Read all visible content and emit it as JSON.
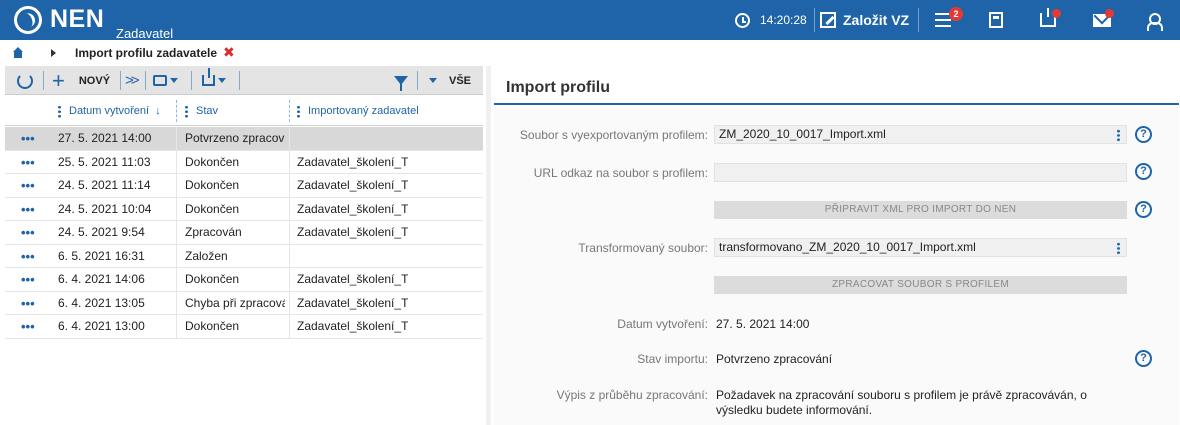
{
  "topbar": {
    "logo": "NEN",
    "logo_sub": "Zadavatel",
    "time": "14:20:28",
    "create_label": "Založit VZ",
    "menu_badge": "2",
    "colors": {
      "brand": "#1f64a8",
      "badge": "#e53935"
    }
  },
  "breadcrumb": {
    "current": "Import profilu zadavatele",
    "close": "✖"
  },
  "toolbar": {
    "new_label": "NOVÝ",
    "all_label": "VŠE"
  },
  "table": {
    "columns": [
      "Datum vytvoření",
      "Stav",
      "Importovaný zadavatel"
    ],
    "sort_indicator": "↓",
    "row_menu": "•••",
    "rows": [
      {
        "date": "27. 5. 2021 14:00",
        "state": "Potvrzeno zpracování",
        "importer": ""
      },
      {
        "date": "25. 5. 2021 11:03",
        "state": "Dokončen",
        "importer": "Zadavatel_školení_T"
      },
      {
        "date": "24. 5. 2021 11:14",
        "state": "Dokončen",
        "importer": "Zadavatel_školení_T"
      },
      {
        "date": "24. 5. 2021 10:04",
        "state": "Dokončen",
        "importer": "Zadavatel_školení_T"
      },
      {
        "date": "24. 5. 2021 9:54",
        "state": "Zpracován",
        "importer": "Zadavatel_školení_T"
      },
      {
        "date": "6. 5. 2021 16:31",
        "state": "Založen",
        "importer": ""
      },
      {
        "date": "6. 4. 2021 14:06",
        "state": "Dokončen",
        "importer": "Zadavatel_školení_T"
      },
      {
        "date": "6. 4. 2021 13:05",
        "state": "Chyba při zpracování",
        "importer": "Zadavatel_školení_T"
      },
      {
        "date": "6. 4. 2021 13:00",
        "state": "Dokončen",
        "importer": "Zadavatel_školení_T"
      }
    ]
  },
  "detail": {
    "title": "Import profilu",
    "file_label": "Soubor s vyexportovaným profilem:",
    "file_value": "ZM_2020_10_0017_Import.xml",
    "url_label": "URL odkaz na soubor s profilem:",
    "url_value": "",
    "prepare_button": "PŘIPRAVIT XML PRO IMPORT DO NEN",
    "transformed_label": "Transformovaný soubor:",
    "transformed_value": "transformovano_ZM_2020_10_0017_Import.xml",
    "process_button": "ZPRACOVAT SOUBOR S PROFILEM",
    "created_label": "Datum vytvoření:",
    "created_value": "27. 5. 2021 14:00",
    "state_label": "Stav importu:",
    "state_value": "Potvrzeno zpracování",
    "log_label": "Výpis z průběhu zpracování:",
    "log_line1": "Požadavek na zpracování souboru s profilem je právě zpracováván, o",
    "log_line2": "výsledku budete informování.",
    "help": "?"
  }
}
